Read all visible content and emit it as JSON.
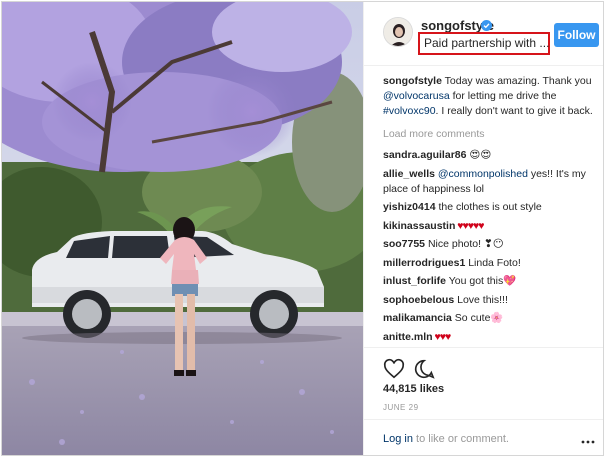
{
  "post": {
    "username": "songofstyle",
    "verified": true,
    "subtitle": "Paid partnership with ...",
    "follow_label": "Follow"
  },
  "caption": {
    "user": "songofstyle",
    "text_1": " Today was amazing. Thank you ",
    "mention": "@volvocarusa",
    "text_2": " for letting me drive the ",
    "hashtag": "#volvoxc90",
    "text_3": ". I really don't want to give it back."
  },
  "load_more": "Load more comments",
  "comments": [
    {
      "user": "sandra.aguilar86",
      "text": " 😍😍"
    },
    {
      "user": "allie_wells",
      "mention": "@commonpolished",
      "text": " yes!! It's my place of happiness lol"
    },
    {
      "user": "yishiz0414",
      "text": " the clothes is out style"
    },
    {
      "user": "kikinassaustin",
      "text": " ♥♥♥♥♥"
    },
    {
      "user": "soo7755",
      "text": " Nice photo! ❣😶"
    },
    {
      "user": "millerrodrigues1",
      "text": " Linda Foto!"
    },
    {
      "user": "inlust_forlife",
      "text": " You got this💖"
    },
    {
      "user": "sophoebelous",
      "text": " Love this!!!"
    },
    {
      "user": "malikamancia",
      "text": " So cute🌸"
    },
    {
      "user": "anitte.mln",
      "text": " ♥♥♥"
    }
  ],
  "likes": "44,815 likes",
  "date": "JUNE 29",
  "footer": {
    "login_link": "Log in",
    "login_text": " to like or comment."
  },
  "icons": [
    "verified-icon",
    "heart-icon",
    "comment-icon",
    "more-options-icon"
  ],
  "colors": {
    "accent": "#3897f0",
    "highlight_box": "#d6141a",
    "link": "#003569"
  }
}
